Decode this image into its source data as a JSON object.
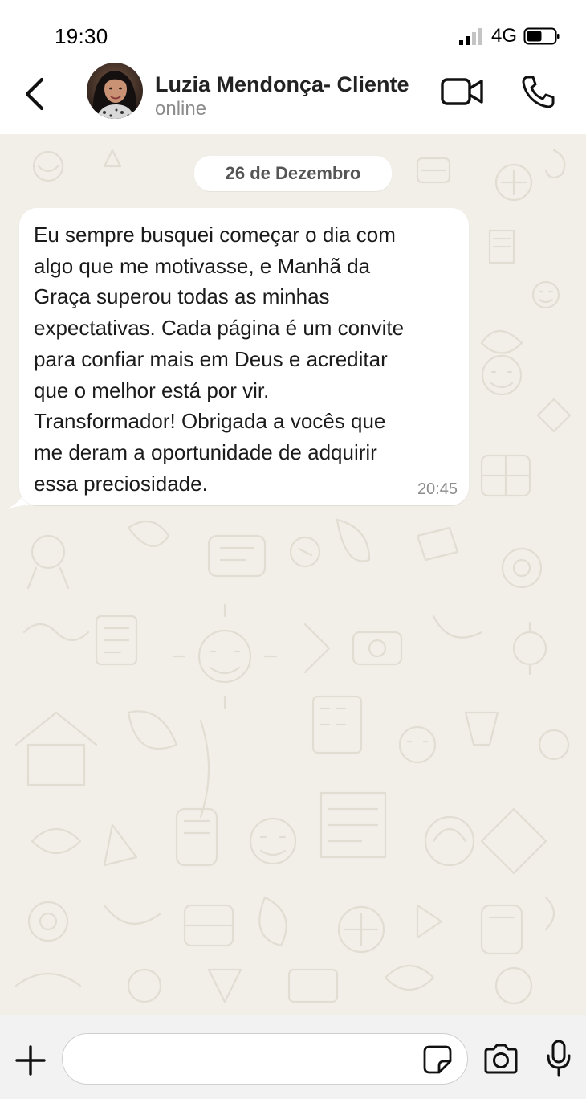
{
  "status_bar": {
    "time": "19:30",
    "network": "4G",
    "signal_icon": "signal-bars-icon",
    "battery_icon": "battery-icon"
  },
  "header": {
    "back_icon": "chevron-left-icon",
    "contact_name": "Luzia Mendonça- Cliente",
    "contact_status": "online",
    "video_call_icon": "video-camera-icon",
    "voice_call_icon": "phone-icon"
  },
  "chat": {
    "date_label": "26 de Dezembro",
    "messages": [
      {
        "direction": "incoming",
        "text": "Eu sempre busquei começar o dia com\nalgo que me motivasse, e Manhã da\nGraça superou todas as minhas\nexpectativas. Cada página é um convite\npara confiar mais em Deus e acreditar\nque o melhor está por vir.\nTransformador! Obrigada a vocês que\nme deram a oportunidade de adquirir\nessa preciosidade.",
        "time": "20:45"
      }
    ]
  },
  "composer": {
    "attach_icon": "plus-icon",
    "input_value": "",
    "input_placeholder": "",
    "sticker_icon": "sticker-icon",
    "camera_icon": "camera-icon",
    "mic_icon": "microphone-icon"
  },
  "colors": {
    "chat_background": "#f2efe8",
    "bubble_incoming": "#ffffff",
    "header_background": "#ffffff",
    "composer_background": "#f2f2f2",
    "status_online": "#8c8c8c"
  }
}
